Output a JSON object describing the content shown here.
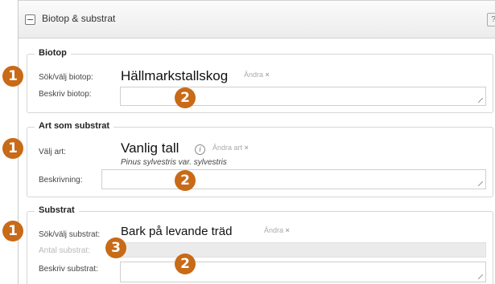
{
  "panel": {
    "title": "Biotop & substrat",
    "help": "?"
  },
  "biotop": {
    "legend": "Biotop",
    "search_label": "Sök/välj biotop:",
    "value": "Hällmarkstallskog",
    "change_label": "Ändra",
    "change_x": "×",
    "describe_label": "Beskriv biotop:"
  },
  "art": {
    "legend": "Art som substrat",
    "select_label": "Välj art:",
    "value": "Vanlig tall",
    "info_icon": "i",
    "change_label": "Ändra art",
    "change_x": "×",
    "scientific_name": "Pinus sylvestris var. sylvestris",
    "describe_label": "Beskrivning:"
  },
  "substrat": {
    "legend": "Substrat",
    "search_label": "Sök/välj substrat:",
    "value": "Bark på levande träd",
    "change_label": "Ändra",
    "change_x": "×",
    "count_label": "Antal substrat:",
    "describe_label": "Beskriv substrat:"
  },
  "badges": {
    "one": "1",
    "two": "2",
    "three": "3"
  },
  "colors": {
    "badge": "#c86a17",
    "border": "#d6d6d6"
  }
}
